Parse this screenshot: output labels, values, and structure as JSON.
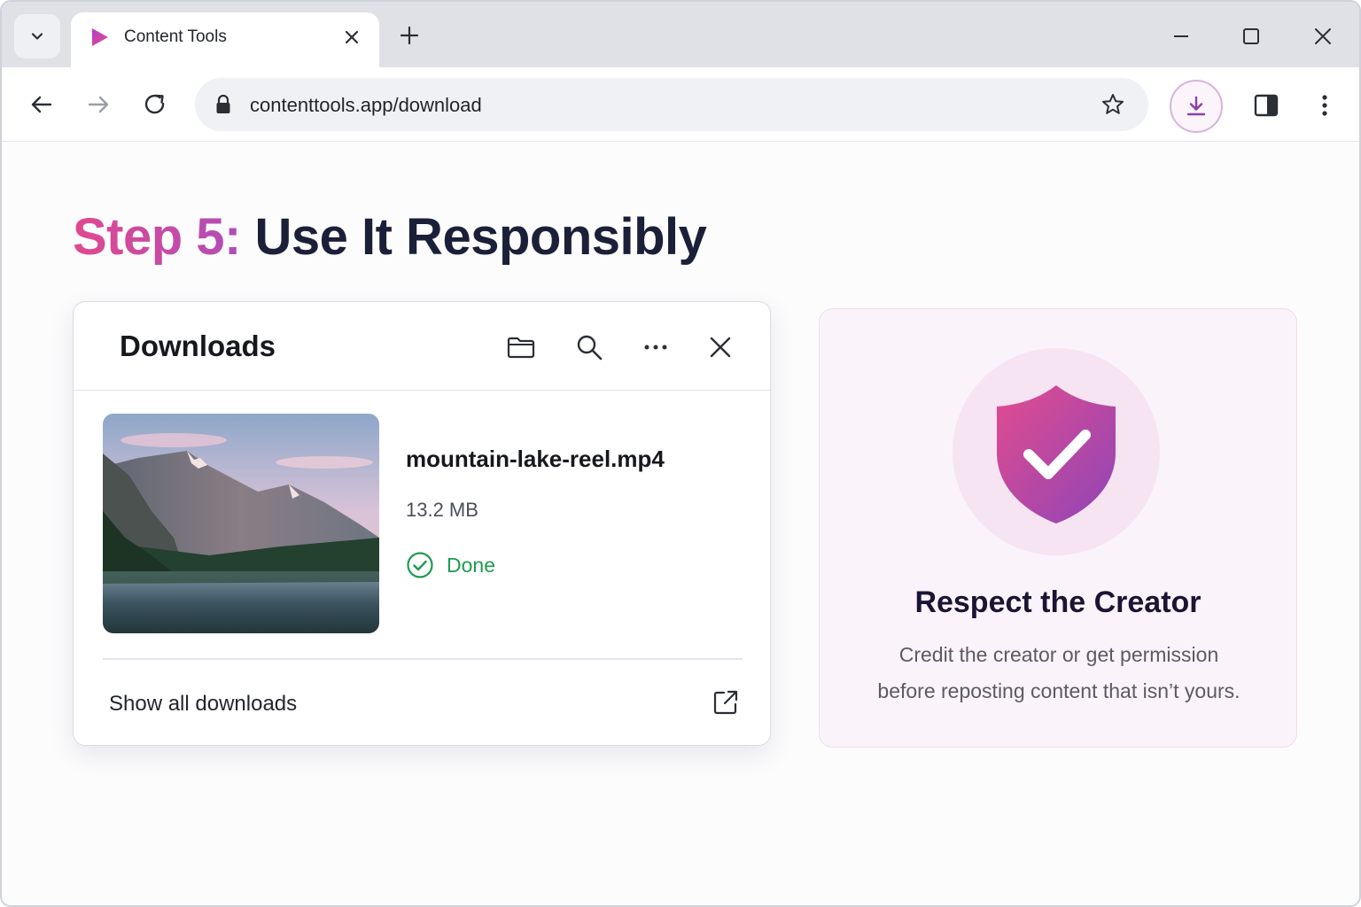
{
  "browser": {
    "tab": {
      "title": "Content Tools",
      "favicon": "play-triangle-icon"
    },
    "address_bar": {
      "url": "contenttools.app/download"
    },
    "toolbar_icons": [
      "back-icon",
      "forward-icon",
      "reload-icon",
      "lock-icon",
      "star-icon",
      "download-icon",
      "side-panel-icon",
      "menu-icon"
    ]
  },
  "page": {
    "heading": {
      "step": "Step 5:",
      "title": "Use It Responsibly"
    },
    "downloads_panel": {
      "title": "Downloads",
      "header_icons": [
        "folder-icon",
        "search-icon",
        "more-icon",
        "close-icon"
      ],
      "item": {
        "file_name": "mountain-lake-reel.mp4",
        "size": "13.2 MB",
        "status": "Done"
      },
      "footer_link": "Show all downloads"
    },
    "card": {
      "title": "Respect the Creator",
      "text_line1": "Credit the creator or get permission",
      "text_line2": "before reposting content that isn’t yours."
    }
  },
  "colors": {
    "accent_pink": "#e0498f",
    "accent_purple": "#9a4cc0",
    "done_green": "#1e9b4e"
  }
}
